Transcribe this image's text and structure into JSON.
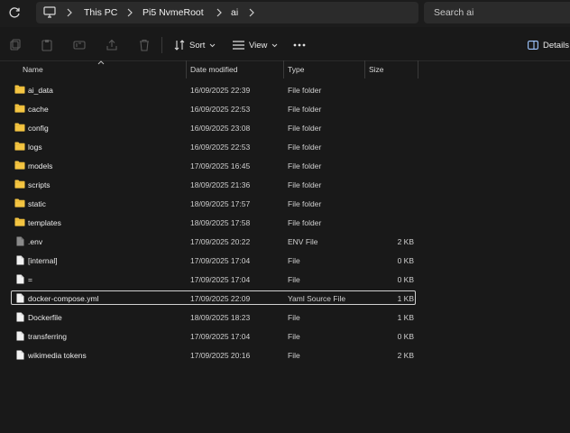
{
  "address_bar": {
    "breadcrumbs": [
      "This PC",
      "Pi5 NvmeRoot",
      "ai"
    ],
    "search_placeholder": "Search ai"
  },
  "command_bar": {
    "sort_label": "Sort",
    "view_label": "View",
    "details_label": "Details"
  },
  "columns": {
    "name": "Name",
    "date": "Date modified",
    "type": "Type",
    "size": "Size"
  },
  "files": [
    {
      "name": "ai_data",
      "date": "16/09/2025 22:39",
      "type": "File folder",
      "size": "",
      "icon": "folder-icon"
    },
    {
      "name": "cache",
      "date": "16/09/2025 22:53",
      "type": "File folder",
      "size": "",
      "icon": "folder-icon"
    },
    {
      "name": "config",
      "date": "16/09/2025 23:08",
      "type": "File folder",
      "size": "",
      "icon": "folder-icon"
    },
    {
      "name": "logs",
      "date": "16/09/2025 22:53",
      "type": "File folder",
      "size": "",
      "icon": "folder-icon"
    },
    {
      "name": "models",
      "date": "17/09/2025 16:45",
      "type": "File folder",
      "size": "",
      "icon": "folder-icon"
    },
    {
      "name": "scripts",
      "date": "18/09/2025 21:36",
      "type": "File folder",
      "size": "",
      "icon": "folder-icon"
    },
    {
      "name": "static",
      "date": "18/09/2025 17:57",
      "type": "File folder",
      "size": "",
      "icon": "folder-icon"
    },
    {
      "name": "templates",
      "date": "18/09/2025 17:58",
      "type": "File folder",
      "size": "",
      "icon": "folder-icon"
    },
    {
      "name": ".env",
      "date": "17/09/2025 20:22",
      "type": "ENV File",
      "size": "2 KB",
      "icon": "env-file-icon"
    },
    {
      "name": "[internal]",
      "date": "17/09/2025 17:04",
      "type": "File",
      "size": "0 KB",
      "icon": "file-icon"
    },
    {
      "name": "=",
      "date": "17/09/2025 17:04",
      "type": "File",
      "size": "0 KB",
      "icon": "file-icon"
    },
    {
      "name": "docker-compose.yml",
      "date": "17/09/2025 22:09",
      "type": "Yaml Source File",
      "size": "1 KB",
      "icon": "file-icon",
      "selected": true
    },
    {
      "name": "Dockerfile",
      "date": "18/09/2025 18:23",
      "type": "File",
      "size": "1 KB",
      "icon": "file-icon"
    },
    {
      "name": "transferring",
      "date": "17/09/2025 17:04",
      "type": "File",
      "size": "0 KB",
      "icon": "file-icon"
    },
    {
      "name": "wikimedia tokens",
      "date": "17/09/2025 20:16",
      "type": "File",
      "size": "2 KB",
      "icon": "file-icon"
    }
  ],
  "colors": {
    "background": "#191919",
    "folder": "#f4c542",
    "selection_border": "#d0d0d0"
  }
}
